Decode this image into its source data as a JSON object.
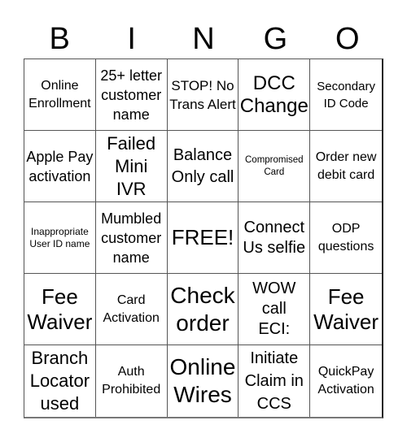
{
  "header": {
    "letters": [
      "B",
      "I",
      "N",
      "G",
      "O"
    ]
  },
  "cells": [
    {
      "label": "Online Enrollment"
    },
    {
      "label": "25+ letter customer name"
    },
    {
      "label": "STOP! No Trans Alert"
    },
    {
      "label": "DCC Change"
    },
    {
      "label": "Secondary ID Code"
    },
    {
      "label": "Apple Pay activation"
    },
    {
      "label": "Failed Mini IVR"
    },
    {
      "label": "Balance Only call"
    },
    {
      "label": "Compromised Card"
    },
    {
      "label": "Order new debit card"
    },
    {
      "label": "Inappropriate User ID name"
    },
    {
      "label": "Mumbled customer name"
    },
    {
      "label": "FREE!"
    },
    {
      "label": "Connect Us selfie"
    },
    {
      "label": "ODP questions"
    },
    {
      "label": "Fee Waiver"
    },
    {
      "label": "Card Activation"
    },
    {
      "label": "Check order"
    },
    {
      "label": "WOW call ECI:"
    },
    {
      "label": "Fee Waiver"
    },
    {
      "label": "Branch Locator used"
    },
    {
      "label": "Auth Prohibited"
    },
    {
      "label": "Online Wires"
    },
    {
      "label": "Initiate Claim in CCS"
    },
    {
      "label": "QuickPay Activation"
    }
  ]
}
